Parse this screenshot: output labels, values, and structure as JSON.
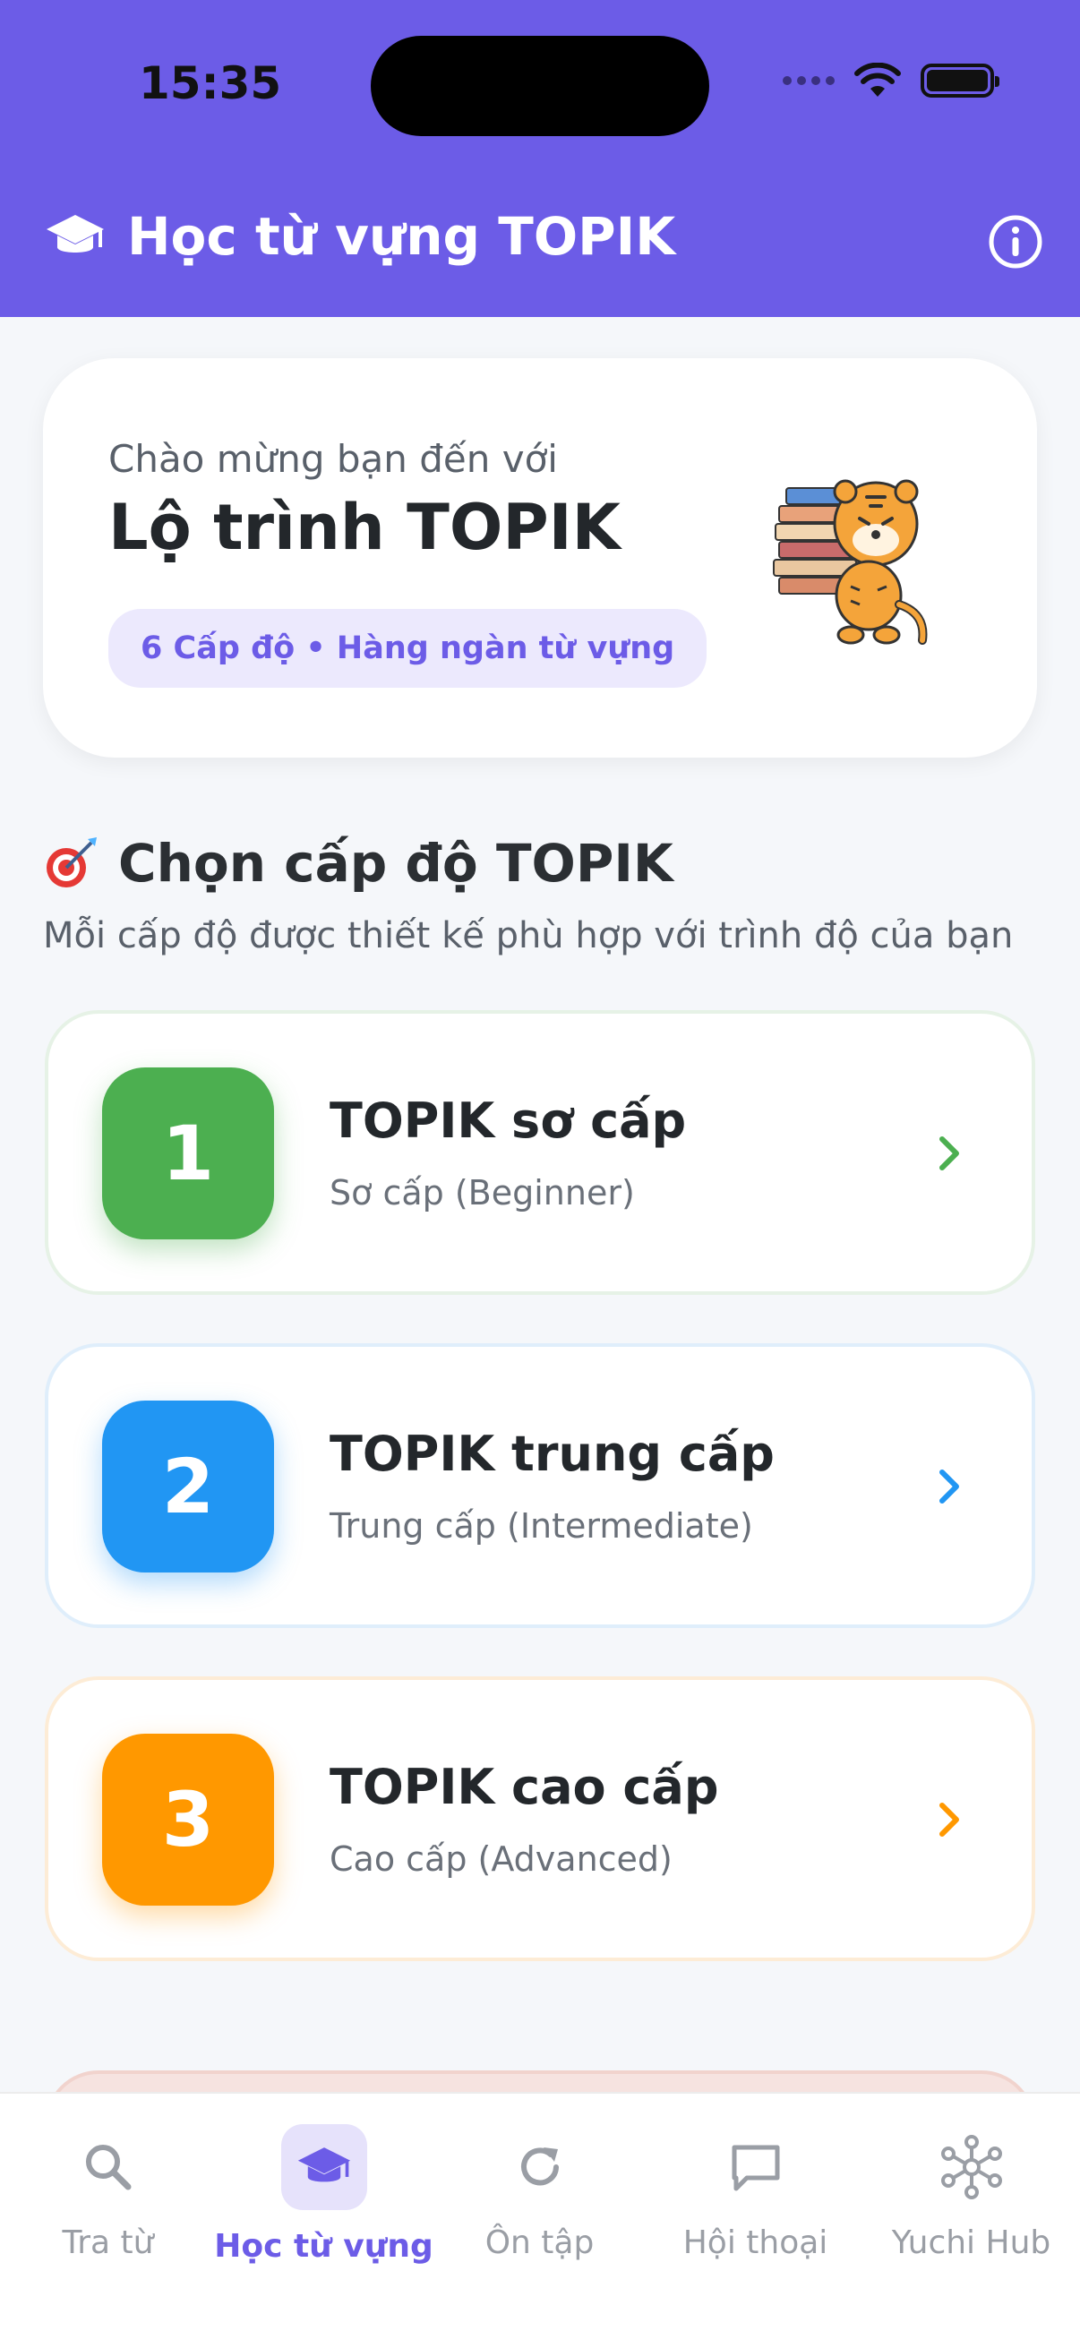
{
  "status_bar": {
    "time": "15:35"
  },
  "header": {
    "title": "Học từ vựng TOPIK"
  },
  "welcome": {
    "subtitle": "Chào mừng bạn đến với",
    "title": "Lộ trình TOPIK",
    "badge": "6 Cấp độ • Hàng ngàn từ vựng"
  },
  "section": {
    "title": "Chọn cấp độ TOPIK",
    "description": "Mỗi cấp độ được thiết kế phù hợp với trình độ của bạn"
  },
  "levels": [
    {
      "number": "1",
      "name": "TOPIK sơ cấp",
      "desc": "Sơ cấp (Beginner)",
      "color": "#4CAF50"
    },
    {
      "number": "2",
      "name": "TOPIK trung cấp",
      "desc": "Trung cấp (Intermediate)",
      "color": "#2196F3"
    },
    {
      "number": "3",
      "name": "TOPIK cao cấp",
      "desc": "Cao cấp (Advanced)",
      "color": "#FF9800"
    }
  ],
  "tabs": [
    {
      "label": "Tra từ",
      "icon": "search-icon"
    },
    {
      "label": "Học từ vựng",
      "icon": "graduation-cap-icon",
      "active": true
    },
    {
      "label": "Ôn tập",
      "icon": "refresh-icon"
    },
    {
      "label": "Hội thoại",
      "icon": "chat-bubble-icon"
    },
    {
      "label": "Yuchi Hub",
      "icon": "network-hub-icon"
    }
  ],
  "colors": {
    "primary": "#6C5CE7",
    "badge_bg": "#ECE9FD"
  }
}
